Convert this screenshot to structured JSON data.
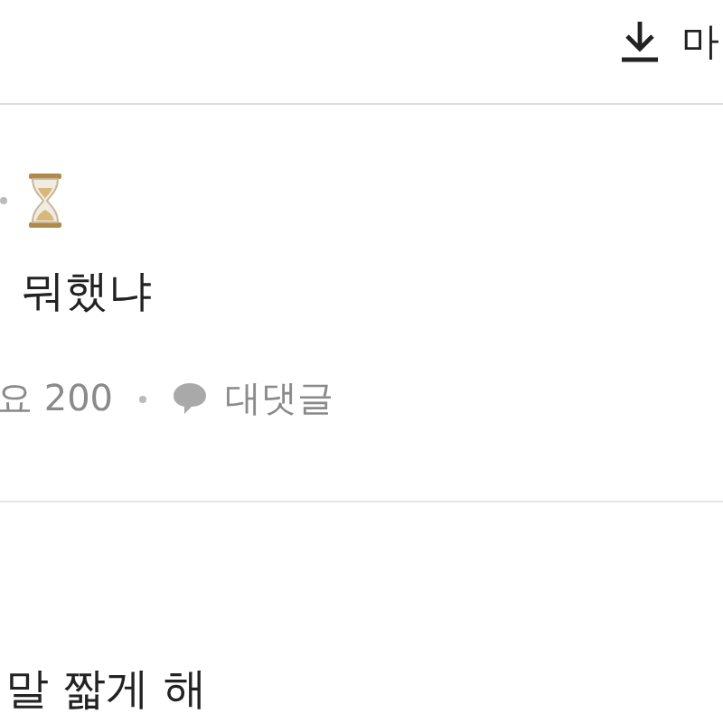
{
  "header": {
    "download_label": "마"
  },
  "comments": [
    {
      "kind": "full",
      "text": "뭐했냐",
      "likes": "요 200",
      "reply_label": "대댓글"
    },
    {
      "kind": "text",
      "text": "말 짧게 해"
    }
  ]
}
